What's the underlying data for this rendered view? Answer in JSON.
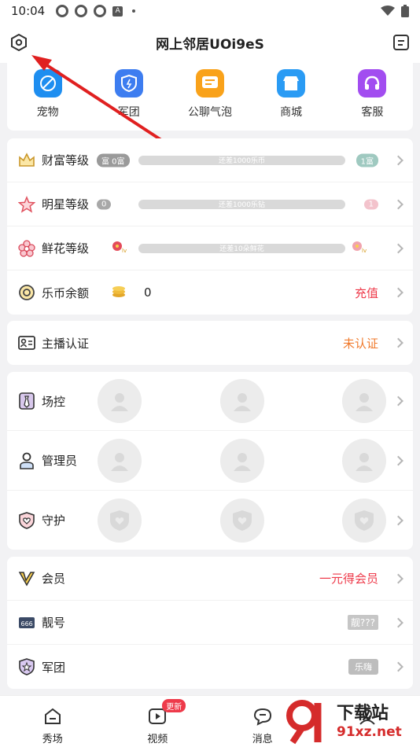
{
  "status": {
    "time": "10:04",
    "app_icon_letter": "A"
  },
  "header": {
    "title": "网上邻居UOi9eS"
  },
  "quick": [
    {
      "label": "宠物",
      "color": "#1e8ef0"
    },
    {
      "label": "军团",
      "color": "#3d7df0"
    },
    {
      "label": "公聊气泡",
      "color": "#f9a21a"
    },
    {
      "label": "商城",
      "color": "#2a9bf4"
    },
    {
      "label": "客服",
      "color": "#a24df0"
    }
  ],
  "levels": [
    {
      "label": "财富等级",
      "left_badge": "富 0富",
      "bar_text": "还差1000乐币",
      "right_badge": "1富"
    },
    {
      "label": "明星等级",
      "left_badge": "0",
      "bar_text": "还差1000乐钻",
      "right_badge": "1"
    },
    {
      "label": "鲜花等级",
      "left_badge": "",
      "bar_text": "还差10朵鲜花",
      "right_badge": ""
    }
  ],
  "balance": {
    "label": "乐币余额",
    "value": "0",
    "action": "充值"
  },
  "anchor": {
    "label": "主播认证",
    "status": "未认证"
  },
  "roles": [
    {
      "label": "场控"
    },
    {
      "label": "管理员"
    },
    {
      "label": "守护"
    }
  ],
  "member": {
    "label": "会员",
    "action": "一元得会员"
  },
  "nice_number": {
    "label": "靓号",
    "value": "靓???"
  },
  "legion": {
    "label": "军团",
    "value": "乐嗨"
  },
  "tabs": [
    {
      "label": "秀场"
    },
    {
      "label": "视频",
      "badge": "更新"
    },
    {
      "label": "消息"
    }
  ],
  "watermark": {
    "title": "下载站",
    "url": "91xz.net"
  }
}
